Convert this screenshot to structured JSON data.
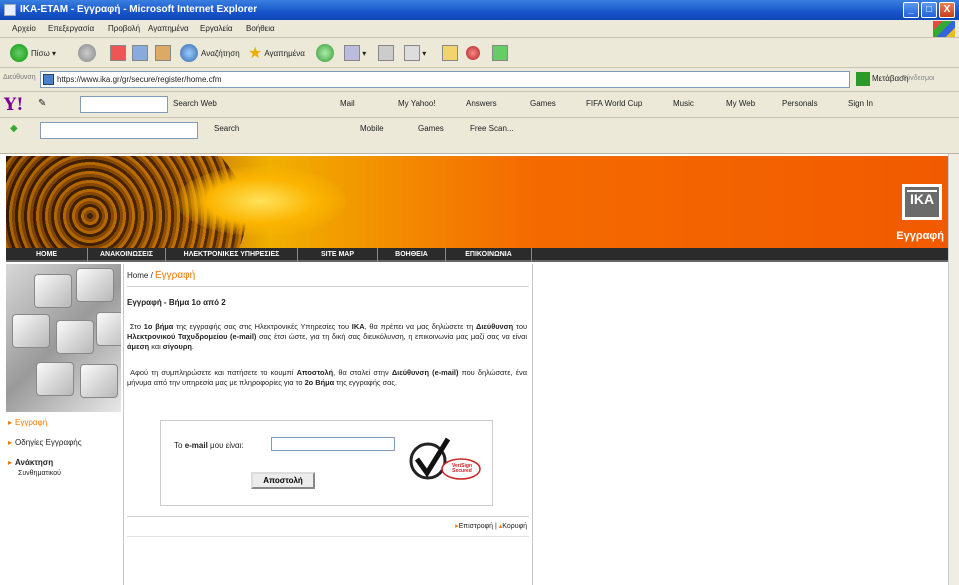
{
  "window": {
    "title": "ΙΚΑ-ΕΤΑΜ - Εγγραφή - Microsoft Internet Explorer",
    "min_label": "_",
    "max_label": "□",
    "close_label": "X"
  },
  "menubar": [
    "Αρχείο",
    "Επεξεργασία",
    "Προβολή",
    "Αγαπημένα",
    "Εργαλεία",
    "Βοήθεια"
  ],
  "toolbar": {
    "back_label": "Πίσω",
    "search_label": "Αναζήτηση",
    "favorites_label": "Αγαπημένα"
  },
  "addressbar": {
    "label": "Διεύθυνση",
    "url": "https://www.ika.gr/gr/secure/register/home.cfm",
    "go_label": "Μετάβαση",
    "links_label": "Σύνδεσμοι"
  },
  "yahoo_toolbar": {
    "logo": "Y!",
    "items": [
      "Search Web",
      "Mail",
      "My Yahoo!",
      "Answers",
      "Games",
      "FIFA World Cup",
      "Music",
      "My Web",
      "Personals",
      "Sign In"
    ]
  },
  "search_toolbar": {
    "items": [
      "Search",
      "Mobile",
      "Games",
      "Free Scan..."
    ]
  },
  "banner": {
    "logo_text": "IKA",
    "title": "Εγγραφή"
  },
  "nav": [
    "HOME",
    "ΑΝΑΚΟΙΝΩΣΕΙΣ",
    "ΗΛΕΚΤΡΟΝΙΚΕΣ ΥΠΗΡΕΣΙΕΣ",
    "SITE MAP",
    "ΒΟΗΘΕΙΑ",
    "ΕΠΙΚΟΙΝΩΝΙΑ"
  ],
  "sidenav": [
    {
      "label": "Εγγραφή"
    },
    {
      "label": "Οδηγίες Εγγραφής"
    },
    {
      "label": "Ανάκτηση",
      "sub": "Συνθηματικού"
    }
  ],
  "content": {
    "breadcrumb_home": "Home",
    "breadcrumb_sep": " / ",
    "breadcrumb_current": "Εγγραφή",
    "step_title": "Εγγραφή - Βήμα 1ο από 2",
    "para1_a": "Στο ",
    "para1_b": "1ο βήμα",
    "para1_c": " της εγγραφής σας στις Ηλεκτρονικές Υπηρεσίες του ",
    "para1_d": "ΙΚΑ",
    "para1_e": ", θα πρέπει να μας δηλώσετε τη ",
    "para1_f": "Διεύθυνση",
    "para1_g": " του ",
    "para1_h": "Ηλεκτρονικού Ταχυδρομείου (e-mail)",
    "para1_i": " σας έτσι ώστε, για τη δική σας διευκόλυνση, η επικοινωνία μας μαζί σας να είναι ",
    "para1_j": "άμεση",
    "para1_k": " και ",
    "para1_l": "σίγουρη",
    "para2_a": "Αφού τη συμπληρώσετε και πατήσετε το κουμπί ",
    "para2_b": "Αποστολή",
    "para2_c": ", θα σταλεί στην ",
    "para2_d": "Διεύθυνση (e-mail)",
    "para2_e": " που δηλώσατε, ένα μήνυμα από την υπηρεσία μας με πληροφορίες για το ",
    "para2_f": "2ο Βήμα",
    "para2_g": " της εγγραφής σας.",
    "email_label_a": "Το ",
    "email_label_b": "e-mail",
    "email_label_c": " μου είναι:",
    "email_value": "",
    "send_button": "Αποστολή",
    "seal_text": "VeriSign Secured",
    "footer_back": "Επιστροφή",
    "footer_sep": "|",
    "footer_top": "Κορυφή"
  }
}
